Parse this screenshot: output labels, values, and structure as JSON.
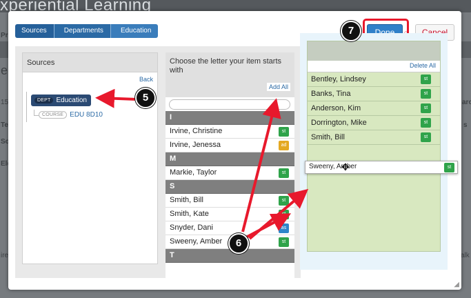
{
  "background": {
    "title": "xperiential Learning",
    "fragments": [
      "Pr",
      "e",
      "15",
      "Ter",
      "Soc",
      "Ele",
      "arc",
      "s",
      "ire",
      "alk"
    ]
  },
  "breadcrumb": [
    "Sources",
    "Departments",
    "Education"
  ],
  "buttons": {
    "done": "Done",
    "cancel": "Cancel"
  },
  "sources": {
    "title": "Sources",
    "back": "Back",
    "dept": {
      "tag": "DEPT",
      "label": "Education"
    },
    "course": {
      "tag": "COURSE",
      "label": "EDU 8D10"
    }
  },
  "picker": {
    "title": "Choose the letter your item starts with",
    "add_all": "Add All",
    "search_value": "",
    "rows": [
      {
        "type": "letter",
        "label": "I"
      },
      {
        "type": "person",
        "name": "Irvine, Christine",
        "badge": "st"
      },
      {
        "type": "person",
        "name": "Irvine, Jenessa",
        "badge": "ad"
      },
      {
        "type": "letter",
        "label": "M"
      },
      {
        "type": "person",
        "name": "Markie, Taylor",
        "badge": "st"
      },
      {
        "type": "letter",
        "label": "S"
      },
      {
        "type": "person",
        "name": "Smith, Bill",
        "badge": "st"
      },
      {
        "type": "person",
        "name": "Smith, Kate",
        "badge": "st"
      },
      {
        "type": "person",
        "name": "Snyder, Dani",
        "badge": "as"
      },
      {
        "type": "person",
        "name": "Sweeny, Amber",
        "badge": "st"
      },
      {
        "type": "letter",
        "label": "T"
      }
    ]
  },
  "selected": {
    "delete_all": "Delete All",
    "rows": [
      {
        "name": "Bentley, Lindsey",
        "badge": "st"
      },
      {
        "name": "Banks, Tina",
        "badge": "st"
      },
      {
        "name": "Anderson, Kim",
        "badge": "st"
      },
      {
        "name": "Dorrington, Mike",
        "badge": "st"
      },
      {
        "name": "Smith, Bill",
        "badge": "st"
      }
    ]
  },
  "dragging": {
    "name": "Sweeny, Amber",
    "badge": "st"
  },
  "callouts": {
    "c5": "5",
    "c6": "6",
    "c7": "7"
  },
  "colors": {
    "accent": "#2f80c9",
    "annotation_red": "#e8192c",
    "badge_st": "#2fa34a",
    "badge_ad": "#e4a822",
    "badge_as": "#2e86c9",
    "dept_navy": "#2b4a73"
  }
}
